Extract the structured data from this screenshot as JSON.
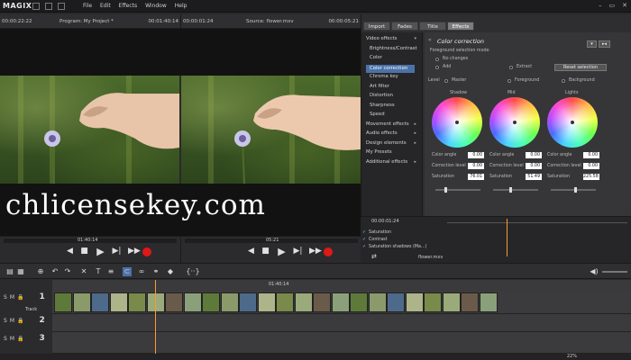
{
  "app": {
    "logo": "MAGIX",
    "menu": [
      "File",
      "Edit",
      "Effects",
      "Window",
      "Help"
    ],
    "window_buttons": [
      "–",
      "▭",
      "✕"
    ]
  },
  "program_monitor": {
    "timecode_left": "00:00:22:22",
    "title": "Program: My Project *",
    "timecode_right": "00:01:40:14",
    "scrub_time": "01:40:14"
  },
  "source_monitor": {
    "timecode_left": "00:00:01:24",
    "title": "Source: flower.mxv",
    "timecode_right": "00:00:05:21",
    "scrub_time": "05:21"
  },
  "watermark": "chlicensekey.com",
  "tabs": [
    "Import",
    "Fades",
    "Title",
    "Effects"
  ],
  "effects_list": [
    {
      "label": "Video effects",
      "level": 0,
      "arrow": "▾"
    },
    {
      "label": "Brightness/Contrast",
      "level": 1
    },
    {
      "label": "Color",
      "level": 1
    },
    {
      "label": "Color correction",
      "level": 1,
      "selected": true
    },
    {
      "label": "Chroma key",
      "level": 1
    },
    {
      "label": "Art filter",
      "level": 1
    },
    {
      "label": "Distortion",
      "level": 1
    },
    {
      "label": "Sharpness",
      "level": 1
    },
    {
      "label": "Speed",
      "level": 1
    },
    {
      "label": "Movement effects",
      "level": 0,
      "arrow": "▸"
    },
    {
      "label": "Audio effects",
      "level": 0,
      "arrow": "▸"
    },
    {
      "label": "Design elements",
      "level": 0,
      "arrow": "▸"
    },
    {
      "label": "My Presets",
      "level": 0
    },
    {
      "label": "Additional effects",
      "level": 0,
      "arrow": "▸"
    }
  ],
  "color_correction": {
    "title": "Color correction",
    "section": "Foreground selection mode",
    "options": [
      "No changes",
      "Add",
      "Extract"
    ],
    "reset_button": "Reset selection",
    "level_label": "Level",
    "level_options": [
      "Master",
      "Foreground",
      "Background"
    ],
    "wheels": [
      {
        "name": "Shadow",
        "color_angle": "0.00",
        "correction_level": "0.00",
        "saturation": "76.01"
      },
      {
        "name": "Mid",
        "color_angle": "0.00",
        "correction_level": "0.00",
        "saturation": "51.49"
      },
      {
        "name": "Lights",
        "color_angle": "0.00",
        "correction_level": "0.00",
        "saturation": "225.58"
      }
    ],
    "field_labels": [
      "Color angle",
      "Correction level",
      "Saturation"
    ],
    "corner_buttons": [
      "▾",
      "▸◂"
    ]
  },
  "keyframes": {
    "timecode": "00:00:01:24",
    "rows": [
      "Saturation",
      "Contrast",
      "Saturation shadows (Ma...)"
    ],
    "clip": "flower.mxv"
  },
  "timeline": {
    "ruler_time": "01:40:14",
    "track_labels": [
      "1",
      "2",
      "3"
    ],
    "track_name": "Track",
    "track_buttons": [
      "S",
      "M",
      "🔒"
    ],
    "zoom": "22%"
  },
  "colors": {
    "accent": "#4a72a8",
    "playhead": "#ff9a2a",
    "record": "#e01818"
  }
}
